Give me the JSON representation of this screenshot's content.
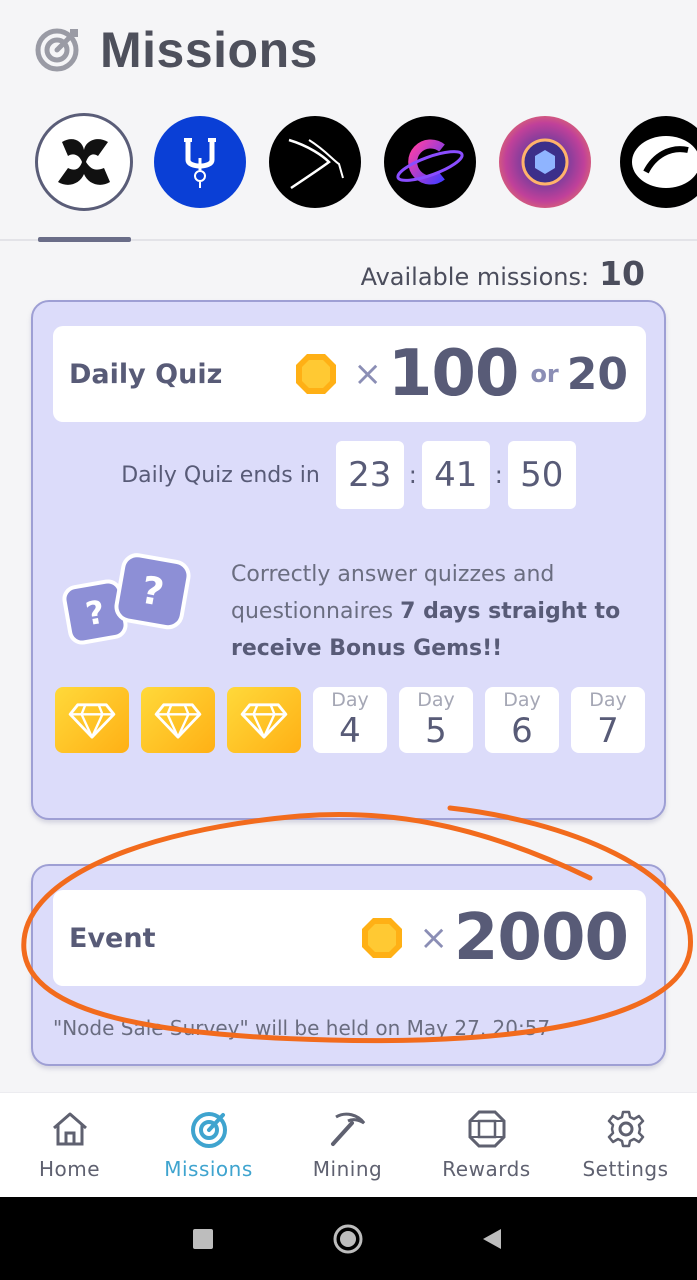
{
  "header": {
    "title": "Missions",
    "icon": "target-icon"
  },
  "projects": [
    {
      "name": "project-1",
      "bg": "#ffffff",
      "selected": true
    },
    {
      "name": "project-2",
      "bg": "#0a3fd6"
    },
    {
      "name": "project-3",
      "bg": "#000000"
    },
    {
      "name": "project-4",
      "bg": "#000000"
    },
    {
      "name": "project-5",
      "bg": "#5a3aa8"
    },
    {
      "name": "project-6",
      "bg": "#000000"
    }
  ],
  "available": {
    "label": "Available missions:",
    "count": "10"
  },
  "daily_quiz": {
    "title": "Daily Quiz",
    "times": "×",
    "reward": "100",
    "or": "or",
    "alt_reward": "20",
    "countdown_label": "Daily Quiz ends in",
    "hours": "23",
    "minutes": "41",
    "seconds": "50",
    "colon": ":",
    "desc_plain": "Correctly answer quizzes and questionnaires ",
    "desc_bold": "7 days straight to receive Bonus Gems!!",
    "days_done": 3,
    "days": [
      {
        "label": "Day",
        "num": "4"
      },
      {
        "label": "Day",
        "num": "5"
      },
      {
        "label": "Day",
        "num": "6"
      },
      {
        "label": "Day",
        "num": "7"
      }
    ]
  },
  "event": {
    "title": "Event",
    "times": "×",
    "reward": "2000",
    "note": "\"Node Sale Survey\" will be held on May 27, 20:57"
  },
  "nav": [
    {
      "label": "Home",
      "icon": "home-icon"
    },
    {
      "label": "Missions",
      "icon": "target-icon",
      "active": true
    },
    {
      "label": "Mining",
      "icon": "pickaxe-icon"
    },
    {
      "label": "Rewards",
      "icon": "gem-icon"
    },
    {
      "label": "Settings",
      "icon": "gear-icon"
    }
  ],
  "colors": {
    "accent": "#3fa4cf",
    "card_bg": "#dcdcfa",
    "card_border": "#9e9fd4",
    "gem": "#ffb015",
    "annotation": "#f26b1d"
  }
}
